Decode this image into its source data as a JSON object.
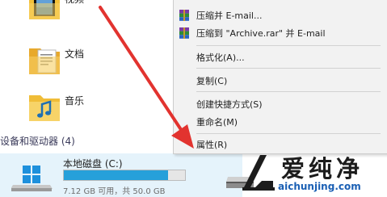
{
  "folders": [
    {
      "label": "视频",
      "icon": "video-folder-icon"
    },
    {
      "label": "文档",
      "icon": "documents-folder-icon"
    },
    {
      "label": "音乐",
      "icon": "music-folder-icon"
    }
  ],
  "devices_section": {
    "title": "设备和驱动器 (4)"
  },
  "drive": {
    "name": "本地磁盘 (C:)",
    "free_text": "7.12 GB 可用，共 50.0 GB",
    "used_fraction": 0.858
  },
  "context_menu": {
    "items": [
      {
        "label": "压缩并 E-mail...",
        "icon": "winrar-archive-icon"
      },
      {
        "label": "压缩到 \"Archive.rar\" 并 E-mail",
        "icon": "winrar-archive-icon"
      },
      {
        "label": "格式化(A)..."
      },
      {
        "label": "复制(C)"
      },
      {
        "label": "创建快捷方式(S)"
      },
      {
        "label": "重命名(M)"
      },
      {
        "label": "属性(R)"
      }
    ]
  },
  "watermark": {
    "text": "爱纯净",
    "url": "aichunjing.com"
  },
  "colors": {
    "accent": "#26a0da",
    "arrow": "#e2332f",
    "menu_bg": "#f2f2f2",
    "selection_bg": "#e5f3fb",
    "watermark_url": "#1a5fb4"
  }
}
